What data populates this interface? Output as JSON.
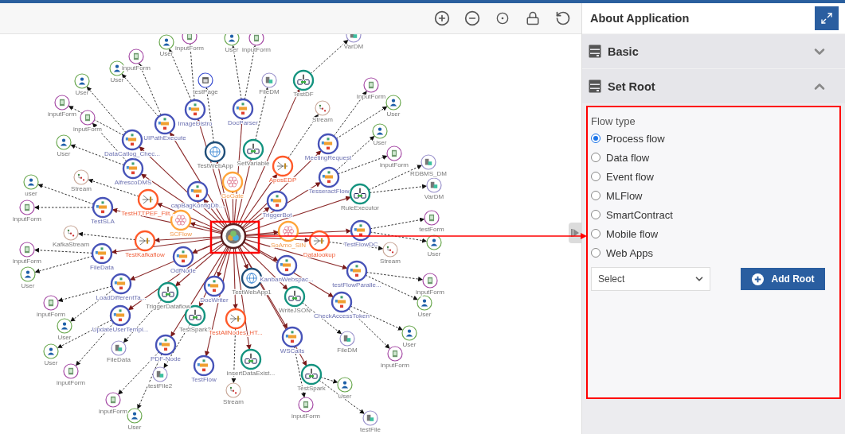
{
  "panel": {
    "title": "About Application",
    "sections": [
      {
        "title": "Basic",
        "expanded": false
      },
      {
        "title": "Set Root",
        "expanded": true
      }
    ],
    "form": {
      "label": "Flow type",
      "options": [
        {
          "label": "Process flow",
          "selected": true
        },
        {
          "label": "Data flow",
          "selected": false
        },
        {
          "label": "Event flow",
          "selected": false
        },
        {
          "label": "MLFlow",
          "selected": false
        },
        {
          "label": "SmartContract",
          "selected": false
        },
        {
          "label": "Mobile flow",
          "selected": false
        },
        {
          "label": "Web Apps",
          "selected": false
        }
      ],
      "select": {
        "value": "Select"
      },
      "add_button": "Add Root"
    }
  },
  "graph": {
    "root": {
      "kind": "root",
      "children": [
        {
          "label": "UIPathExecute",
          "kind": "process",
          "children": [
            {
              "label": "User",
              "kind": "user"
            },
            {
              "label": "inputForm",
              "kind": "form"
            }
          ]
        },
        {
          "label": "DataCatlog_Chec...",
          "kind": "process",
          "children": [
            {
              "label": "User",
              "kind": "user"
            },
            {
              "label": "inputForm",
              "kind": "form"
            }
          ]
        },
        {
          "label": "AlfrescoDMS",
          "kind": "process",
          "children": [
            {
              "label": "inputForm",
              "kind": "form"
            },
            {
              "label": "User",
              "kind": "user"
            }
          ]
        },
        {
          "label": "ImageDistro",
          "kind": "process",
          "children": [
            {
              "label": "User",
              "kind": "user"
            },
            {
              "label": "inputForm",
              "kind": "form"
            }
          ]
        },
        {
          "label": "TestWebApp",
          "kind": "webapp",
          "children": [
            {
              "label": "testPage",
              "kind": "page"
            }
          ]
        },
        {
          "label": "DocParser",
          "kind": "process",
          "children": [
            {
              "label": "User",
              "kind": "user"
            },
            {
              "label": "inputForm",
              "kind": "form"
            }
          ]
        },
        {
          "label": "SetVariable",
          "kind": "dataflow",
          "children": [
            {
              "label": "FileDM",
              "kind": "datamodel"
            }
          ]
        },
        {
          "label": "GoGate",
          "kind": "ml"
        },
        {
          "label": "capBagKonfigDb...",
          "kind": "process"
        },
        {
          "label": "TestHTTPEF_Filt...",
          "kind": "event",
          "children": [
            {
              "label": "Stream",
              "kind": "stream"
            }
          ]
        },
        {
          "label": "TestSLA",
          "kind": "process",
          "children": [
            {
              "label": "user",
              "kind": "user"
            },
            {
              "label": "inputForm",
              "kind": "form"
            }
          ]
        },
        {
          "label": "SCFlow",
          "kind": "ml"
        },
        {
          "label": "AposEDP",
          "kind": "event",
          "children": [
            {
              "label": "Stream",
              "kind": "stream"
            }
          ]
        },
        {
          "label": "TriggerBot",
          "kind": "process"
        },
        {
          "label": "TestDF",
          "kind": "dataflow",
          "children": [
            {
              "label": "VarDM",
              "kind": "datamodel"
            }
          ]
        },
        {
          "label": "MeetingRequest",
          "kind": "process",
          "children": [
            {
              "label": "InputForm",
              "kind": "form"
            },
            {
              "label": "User",
              "kind": "user"
            }
          ]
        },
        {
          "label": "TesseractFlow",
          "kind": "process",
          "children": [
            {
              "label": "User",
              "kind": "user"
            },
            {
              "label": "inputForm",
              "kind": "form"
            }
          ]
        },
        {
          "label": "RuleExecutor",
          "kind": "dataflow",
          "children": [
            {
              "label": "RDBMS_DM",
              "kind": "datamodel"
            },
            {
              "label": "VarDM",
              "kind": "datamodel"
            }
          ]
        },
        {
          "label": "TestFlowDC",
          "kind": "process",
          "children": [
            {
              "label": "testForm",
              "kind": "form"
            },
            {
              "label": "User",
              "kind": "user"
            }
          ]
        },
        {
          "label": "SoAmo_SIN",
          "kind": "ml"
        },
        {
          "label": "Datalookup",
          "kind": "event",
          "children": [
            {
              "label": "Stream",
              "kind": "stream"
            }
          ]
        },
        {
          "label": "KanbanWebspac...",
          "kind": "process"
        },
        {
          "label": "testFlowParalle...",
          "kind": "process",
          "children": [
            {
              "label": "inputForm",
              "kind": "form"
            },
            {
              "label": "User",
              "kind": "user"
            }
          ]
        },
        {
          "label": "WriteJSON",
          "kind": "dataflow",
          "children": [
            {
              "label": "FileDM",
              "kind": "datamodel"
            }
          ]
        },
        {
          "label": "CheckAccessToken",
          "kind": "process",
          "children": [
            {
              "label": "User",
              "kind": "user"
            },
            {
              "label": "inputForm",
              "kind": "form"
            }
          ]
        },
        {
          "label": "WSCalls",
          "kind": "process",
          "children": [
            {
              "label": "inputForm",
              "kind": "form"
            }
          ]
        },
        {
          "label": "TestSpark",
          "kind": "dataflow",
          "children": [
            {
              "label": "User",
              "kind": "user"
            },
            {
              "label": "testFile",
              "kind": "datamodel"
            }
          ]
        },
        {
          "label": "TestKafkaflow",
          "kind": "event",
          "children": [
            {
              "label": "KafkaStream",
              "kind": "stream"
            }
          ]
        },
        {
          "label": "FileData",
          "kind": "process",
          "children": [
            {
              "label": "inputForm",
              "kind": "form"
            },
            {
              "label": "User",
              "kind": "user"
            }
          ]
        },
        {
          "label": "OdfNode",
          "kind": "process"
        },
        {
          "label": "LoadDifferentTa...",
          "kind": "process",
          "children": [
            {
              "label": "inputForm",
              "kind": "form"
            },
            {
              "label": "User",
              "kind": "user"
            }
          ]
        },
        {
          "label": "TriggerDataflow",
          "kind": "dataflow",
          "children": [
            {
              "label": "FileData",
              "kind": "datamodel"
            }
          ]
        },
        {
          "label": "DocWriter",
          "kind": "process"
        },
        {
          "label": "TestWebApp1",
          "kind": "webapp"
        },
        {
          "label": "UpdateUserTempl...",
          "kind": "process",
          "children": [
            {
              "label": "User",
              "kind": "user"
            },
            {
              "label": "inputForm",
              "kind": "form"
            }
          ]
        },
        {
          "label": "TestSpark2",
          "kind": "dataflow",
          "children": [
            {
              "label": "testFile2",
              "kind": "datamodel"
            }
          ]
        },
        {
          "label": "TestAllNodes_HT...",
          "kind": "event",
          "children": [
            {
              "label": "Stream",
              "kind": "stream"
            }
          ]
        },
        {
          "label": "PDF-Node",
          "kind": "process",
          "children": [
            {
              "label": "inputForm",
              "kind": "form"
            },
            {
              "label": "User",
              "kind": "user"
            }
          ]
        },
        {
          "label": "insertDataExist...",
          "kind": "dataflow"
        },
        {
          "label": "TestFlow",
          "kind": "process"
        }
      ]
    }
  }
}
